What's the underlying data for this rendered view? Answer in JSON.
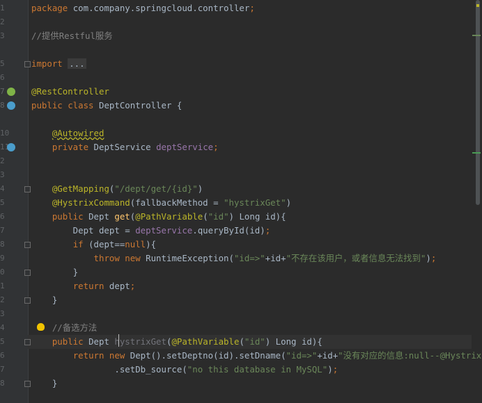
{
  "editor": {
    "line_numbers": [
      "1",
      "2",
      "3",
      "",
      "5",
      "6",
      "7",
      "8",
      "",
      "10",
      "11",
      "2",
      "3",
      "4",
      "5",
      "6",
      "7",
      "8",
      "9",
      "0",
      "1",
      "2",
      "3",
      "4",
      "5",
      "6",
      "7",
      "8"
    ],
    "lines": [
      [
        [
          "kw",
          "package "
        ],
        [
          "plain",
          "com.company.springcloud.controller"
        ],
        [
          "kw",
          ";"
        ]
      ],
      [],
      [
        [
          "cmt",
          "//提供Restful服务"
        ]
      ],
      [],
      [
        [
          "kw",
          "import "
        ],
        [
          "fold-txt",
          "..."
        ]
      ],
      [],
      [
        [
          "an",
          "@RestController"
        ]
      ],
      [
        [
          "kw",
          "public class "
        ],
        [
          "plain",
          "DeptController {"
        ]
      ],
      [],
      [
        [
          "plain",
          "    "
        ],
        [
          "an underline",
          "@Autowired"
        ]
      ],
      [
        [
          "plain",
          "    "
        ],
        [
          "kw",
          "private "
        ],
        [
          "plain",
          "DeptService "
        ],
        [
          "fld",
          "deptService"
        ],
        [
          "kw",
          ";"
        ]
      ],
      [],
      [],
      [
        [
          "plain",
          "    "
        ],
        [
          "an",
          "@GetMapping"
        ],
        [
          "plain",
          "("
        ],
        [
          "str",
          "\"/dept/get/{id}\""
        ],
        [
          "plain",
          ")"
        ]
      ],
      [
        [
          "plain",
          "    "
        ],
        [
          "an",
          "@HystrixCommand"
        ],
        [
          "plain",
          "(fallbackMethod = "
        ],
        [
          "str",
          "\"hystrixGet\""
        ],
        [
          "plain",
          ")"
        ]
      ],
      [
        [
          "plain",
          "    "
        ],
        [
          "kw",
          "public "
        ],
        [
          "plain",
          "Dept "
        ],
        [
          "fn",
          "get"
        ],
        [
          "plain",
          "("
        ],
        [
          "an",
          "@PathVariable"
        ],
        [
          "plain",
          "("
        ],
        [
          "str",
          "\"id\""
        ],
        [
          "plain",
          ") Long id){"
        ]
      ],
      [
        [
          "plain",
          "        Dept dept = "
        ],
        [
          "fld",
          "deptService"
        ],
        [
          "plain",
          ".queryById(id)"
        ],
        [
          "kw",
          ";"
        ]
      ],
      [
        [
          "plain",
          "        "
        ],
        [
          "kw",
          "if "
        ],
        [
          "plain",
          "(dept=="
        ],
        [
          "kw",
          "null"
        ],
        [
          "plain",
          "){"
        ]
      ],
      [
        [
          "plain",
          "            "
        ],
        [
          "kw",
          "throw new "
        ],
        [
          "plain",
          "RuntimeException("
        ],
        [
          "str",
          "\"id=>\""
        ],
        [
          "plain",
          "+id+"
        ],
        [
          "str",
          "\"不存在该用户，或者信息无法找到\""
        ],
        [
          "plain",
          ")"
        ],
        [
          "kw",
          ";"
        ]
      ],
      [
        [
          "plain",
          "        }"
        ]
      ],
      [
        [
          "plain",
          "        "
        ],
        [
          "kw",
          "return "
        ],
        [
          "plain",
          "dept"
        ],
        [
          "kw",
          ";"
        ]
      ],
      [
        [
          "plain",
          "    }"
        ]
      ],
      [],
      [
        [
          "plain",
          "    "
        ],
        [
          "cmt",
          "//备选方法"
        ]
      ],
      [
        [
          "plain",
          "    "
        ],
        [
          "kw",
          "public "
        ],
        [
          "plain",
          "Dept "
        ],
        [
          "unused",
          "hystrixGet"
        ],
        [
          "plain",
          "("
        ],
        [
          "an",
          "@PathVariable"
        ],
        [
          "plain",
          "("
        ],
        [
          "str",
          "\"id\""
        ],
        [
          "plain",
          ") Long id){"
        ]
      ],
      [
        [
          "plain",
          "        "
        ],
        [
          "kw",
          "return new "
        ],
        [
          "plain",
          "Dept().setDeptno(id).setDname("
        ],
        [
          "str",
          "\"id=>\""
        ],
        [
          "plain",
          "+id+"
        ],
        [
          "str",
          "\"没有对应的信息:null--@Hystrix\""
        ],
        [
          "plain",
          ")"
        ]
      ],
      [
        [
          "plain",
          "                .setDb_source("
        ],
        [
          "str",
          "\"no this database in MySQL\""
        ],
        [
          "plain",
          ")"
        ],
        [
          "kw",
          ";"
        ]
      ],
      [
        [
          "plain",
          "    }"
        ]
      ]
    ]
  },
  "gutter_icons": {
    "rest_controller_icon": "spring-bean-icon",
    "class_icon": "spring-bean-run-icon",
    "autowired_icon": "spring-autowire-icon",
    "bulb_icon": "lightbulb-icon"
  },
  "colors": {
    "background": "#2b2b2b",
    "keyword": "#cc7832",
    "annotation": "#bbb529",
    "string": "#6a8759",
    "field": "#9876aa",
    "comment": "#808080"
  }
}
